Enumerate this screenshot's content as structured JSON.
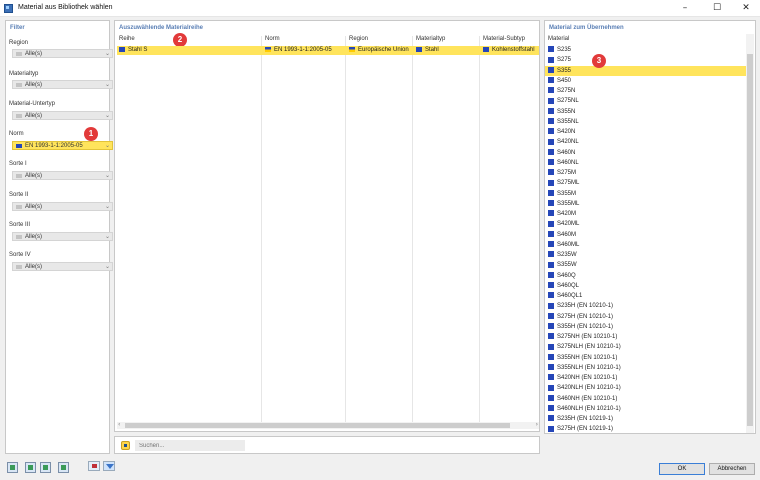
{
  "window": {
    "title": "Material aus Bibliothek wählen",
    "controls": [
      "–",
      "☐",
      "✕"
    ]
  },
  "filter": {
    "header": "Filter",
    "fields": [
      {
        "label": "Region",
        "value": "Alle(s)",
        "active": false
      },
      {
        "label": "Materialtyp",
        "value": "Alle(s)",
        "active": false
      },
      {
        "label": "Material-Untertyp",
        "value": "Alle(s)",
        "active": false
      },
      {
        "label": "Norm",
        "value": "EN 1993-1-1:2005-05",
        "active": true
      },
      {
        "label": "Sorte I",
        "value": "Alle(s)",
        "active": false
      },
      {
        "label": "Sorte II",
        "value": "Alle(s)",
        "active": false
      },
      {
        "label": "Sorte III",
        "value": "Alle(s)",
        "active": false
      },
      {
        "label": "Sorte IV",
        "value": "Alle(s)",
        "active": false
      }
    ]
  },
  "series_panel": {
    "header": "Auszuwählende Materialreihe",
    "columns": [
      "Reihe",
      "Norm",
      "Region",
      "Materialtyp",
      "Material-Subtyp"
    ],
    "rows": [
      {
        "reihe": "Stahl S",
        "norm": "EN 1993-1-1:2005-05",
        "region": "Europäische Union",
        "materialtyp": "Stahl",
        "subtyp": "Kohlenstoffstahl"
      }
    ]
  },
  "material_panel": {
    "header": "Material zum Übernehmen",
    "column": "Material",
    "selected": "S355",
    "items": [
      "S235",
      "S275",
      "S355",
      "S450",
      "S275N",
      "S275NL",
      "S355N",
      "S355NL",
      "S420N",
      "S420NL",
      "S460N",
      "S460NL",
      "S275M",
      "S275ML",
      "S355M",
      "S355ML",
      "S420M",
      "S420ML",
      "S460M",
      "S460ML",
      "S235W",
      "S355W",
      "S460Q",
      "S460QL",
      "S460QL1",
      "S235H (EN 10210-1)",
      "S275H (EN 10210-1)",
      "S355H (EN 10210-1)",
      "S275NH (EN 10210-1)",
      "S275NLH (EN 10210-1)",
      "S355NH (EN 10210-1)",
      "S355NLH (EN 10210-1)",
      "S420NH (EN 10210-1)",
      "S420NLH (EN 10210-1)",
      "S460NH (EN 10210-1)",
      "S460NLH (EN 10210-1)",
      "S235H (EN 10219-1)",
      "S275H (EN 10219-1)"
    ]
  },
  "search": {
    "placeholder": "Suchen..."
  },
  "badges": [
    "1",
    "2",
    "3"
  ],
  "buttons": {
    "ok": "OK",
    "cancel": "Abbrechen"
  },
  "colors": {
    "selection": "#ffe45c",
    "chip": "#2546b8",
    "badge": "#e23a3a",
    "header": "#5a7fb5"
  }
}
